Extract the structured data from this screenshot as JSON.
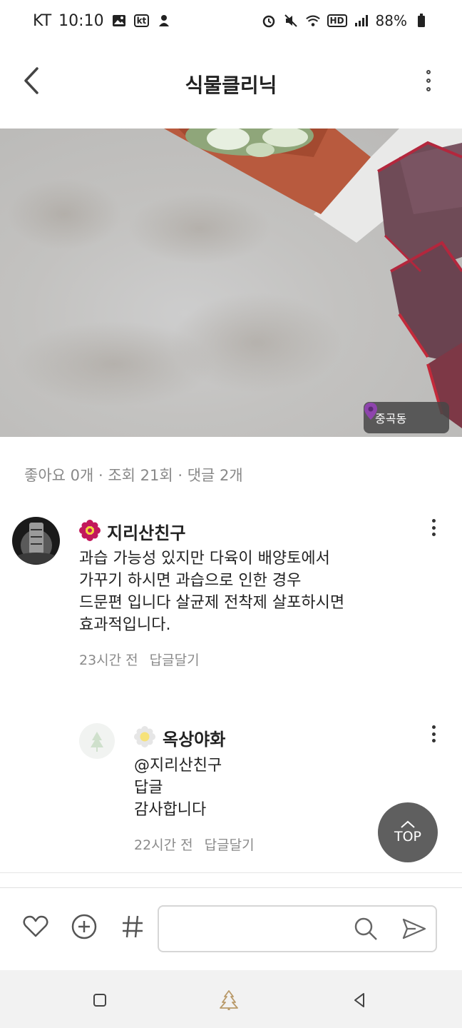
{
  "status_bar": {
    "carrier": "KT",
    "time": "10:10",
    "battery": "88%",
    "icons_left": [
      "gallery-icon",
      "kt-icon",
      "notification-icon"
    ],
    "icons_right": [
      "alarm-icon",
      "mute-icon",
      "wifi-icon",
      "hd-icon",
      "signal-icon",
      "battery-icon"
    ],
    "kt_label": "kt",
    "hd_label": "HD"
  },
  "header": {
    "title": "식물클리닉"
  },
  "photo": {
    "location": "중곡동"
  },
  "stats": {
    "text": "좋아요 0개 · 조회 21회 · 댓글 2개"
  },
  "comments": [
    {
      "author": "지리산친구",
      "body": [
        "과습 가능성 있지만 다육이 배양토에서",
        "가꾸기 하시면 과습으로 인한 경우",
        "드문편 입니다 살균제 전착제 살포하시면",
        "효과적입니다."
      ],
      "time": "23시간 전",
      "reply_label": "답글달기"
    },
    {
      "author": "옥상야화",
      "body": [
        "@지리산친구",
        "답글",
        "감사합니다"
      ],
      "time": "22시간 전",
      "reply_label": "답글달기"
    }
  ],
  "top_button": {
    "label": "TOP"
  },
  "input_bar": {
    "placeholder": ""
  },
  "colors": {
    "accent_badge": "#c2185b",
    "location_pin": "#8e44ad",
    "top_button_bg": "#5f5f5f"
  }
}
